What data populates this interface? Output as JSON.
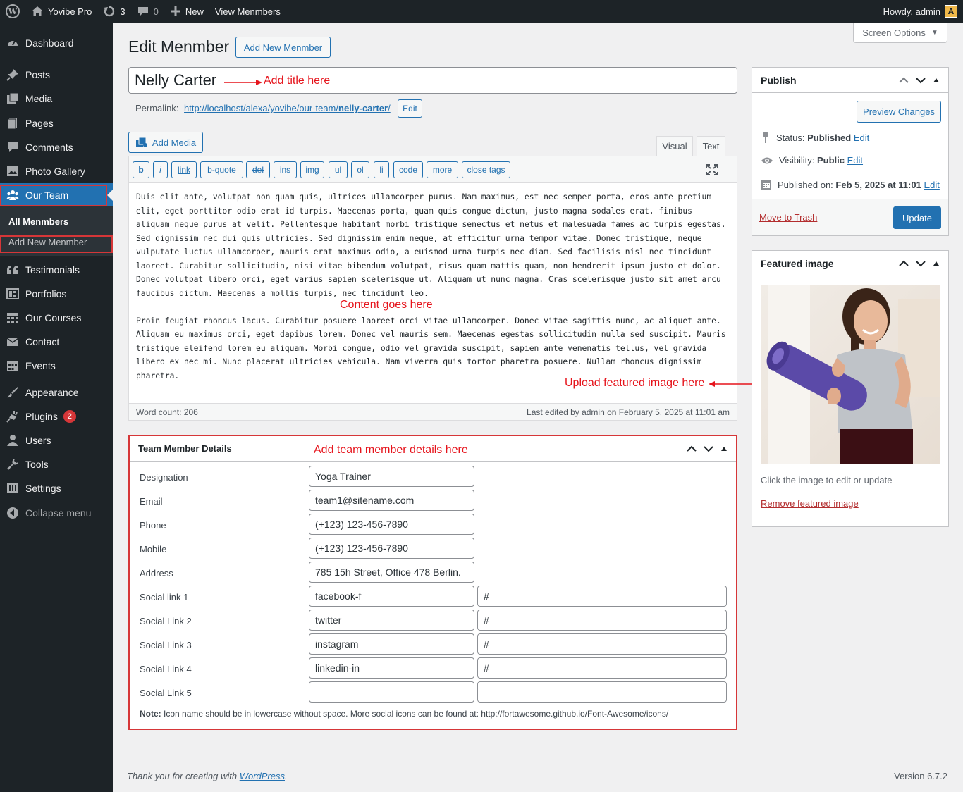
{
  "adminbar": {
    "site_name": "Yovibe Pro",
    "updates_count": "3",
    "comments_count": "0",
    "new_label": "New",
    "view_label": "View Menmbers",
    "howdy": "Howdy, admin",
    "avatar_letter": "A"
  },
  "sidebar": {
    "items": [
      {
        "label": "Dashboard",
        "icon": "dashboard-icon"
      },
      {
        "label": "Posts",
        "icon": "pin-icon"
      },
      {
        "label": "Media",
        "icon": "media-icon"
      },
      {
        "label": "Pages",
        "icon": "pages-icon"
      },
      {
        "label": "Comments",
        "icon": "comment-icon"
      },
      {
        "label": "Photo Gallery",
        "icon": "gallery-icon"
      },
      {
        "label": "Our Team",
        "icon": "team-icon"
      },
      {
        "label": "Testimonials",
        "icon": "quote-icon"
      },
      {
        "label": "Portfolios",
        "icon": "portfolio-icon"
      },
      {
        "label": "Our Courses",
        "icon": "grid-icon"
      },
      {
        "label": "Contact",
        "icon": "mail-icon"
      },
      {
        "label": "Events",
        "icon": "calendar-icon"
      },
      {
        "label": "Appearance",
        "icon": "brush-icon"
      },
      {
        "label": "Plugins",
        "icon": "plugin-icon"
      },
      {
        "label": "Users",
        "icon": "user-icon"
      },
      {
        "label": "Tools",
        "icon": "wrench-icon"
      },
      {
        "label": "Settings",
        "icon": "settings-icon"
      },
      {
        "label": "Collapse menu",
        "icon": "collapse-icon"
      }
    ],
    "submenu": {
      "all": "All Menmbers",
      "add_new": "Add New Menmber"
    },
    "plugins_badge": "2"
  },
  "header": {
    "screen_options": "Screen Options",
    "title": "Edit Menmber",
    "add_new": "Add New Menmber"
  },
  "post": {
    "title": "Nelly Carter",
    "permalink_label": "Permalink:",
    "permalink_base": "http://localhost/alexa/yovibe/our-team/",
    "permalink_slug": "nelly-carter",
    "permalink_trail": "/",
    "permalink_edit": "Edit"
  },
  "annotations": {
    "title": "Add title here",
    "content": "Content goes here",
    "featured": "Upload featured image here",
    "details": "Add team member details here"
  },
  "editor": {
    "add_media": "Add Media",
    "tab_visual": "Visual",
    "tab_text": "Text",
    "quicktags": [
      "b",
      "i",
      "link",
      "b-quote",
      "del",
      "ins",
      "img",
      "ul",
      "ol",
      "li",
      "code",
      "more",
      "close tags"
    ],
    "paragraph1": "Duis elit ante, volutpat non quam quis, ultrices ullamcorper purus. Nam maximus, est nec semper porta, eros ante pretium elit, eget porttitor odio erat id turpis. Maecenas porta, quam quis congue dictum, justo magna sodales erat, finibus aliquam neque purus at velit. Pellentesque habitant morbi tristique senectus et netus et malesuada fames ac turpis egestas. Sed dignissim nec dui quis ultricies. Sed dignissim enim neque, at efficitur urna tempor vitae. Donec tristique, neque vulputate luctus ullamcorper, mauris erat maximus odio, a euismod urna turpis nec diam. Sed facilisis nisl nec tincidunt laoreet. Curabitur sollicitudin, nisi vitae bibendum volutpat, risus quam mattis quam, non hendrerit ipsum justo et dolor. Donec volutpat libero orci, eget varius sapien scelerisque ut. Aliquam ut nunc magna. Cras scelerisque justo sit amet arcu faucibus dictum. Maecenas a mollis turpis, nec tincidunt leo.",
    "paragraph2": "Proin feugiat rhoncus lacus. Curabitur posuere laoreet orci vitae ullamcorper. Donec vitae sagittis nunc, ac aliquet ante. Aliquam eu maximus orci, eget dapibus lorem. Donec vel mauris sem. Maecenas egestas sollicitudin nulla sed suscipit. Mauris tristique eleifend lorem eu aliquam. Morbi congue, odio vel gravida suscipit, sapien ante venenatis tellus, vel gravida libero ex nec mi. Nunc placerat ultricies vehicula. Nam viverra quis tortor pharetra posuere. Nullam rhoncus dignissim pharetra.",
    "word_count": "Word count: 206",
    "last_edited": "Last edited by admin on February 5, 2025 at 11:01 am"
  },
  "details": {
    "title": "Team Member Details",
    "fields": [
      {
        "label": "Designation",
        "value": "Yoga Trainer"
      },
      {
        "label": "Email",
        "value": "team1@sitename.com"
      },
      {
        "label": "Phone",
        "value": "(+123) 123-456-7890"
      },
      {
        "label": "Mobile",
        "value": "(+123) 123-456-7890"
      },
      {
        "label": "Address",
        "value": "785 15h Street, Office 478 Berlin."
      }
    ],
    "social": [
      {
        "label": "Social link 1",
        "icon": "facebook-f",
        "url": "#"
      },
      {
        "label": "Social Link 2",
        "icon": "twitter",
        "url": "#"
      },
      {
        "label": "Social Link 3",
        "icon": "instagram",
        "url": "#"
      },
      {
        "label": "Social Link 4",
        "icon": "linkedin-in",
        "url": "#"
      },
      {
        "label": "Social Link 5",
        "icon": "",
        "url": ""
      }
    ],
    "note_label": "Note:",
    "note_text": "Icon name should be in lowercase without space. More social icons can be found at: http://fortawesome.github.io/Font-Awesome/icons/"
  },
  "publish": {
    "title": "Publish",
    "preview": "Preview Changes",
    "status_label": "Status:",
    "status_value": "Published",
    "visibility_label": "Visibility:",
    "visibility_value": "Public",
    "published_label": "Published on:",
    "published_value": "Feb 5, 2025 at 11:01",
    "edit": "Edit",
    "trash": "Move to Trash",
    "update": "Update"
  },
  "featured": {
    "title": "Featured image",
    "hint": "Click the image to edit or update",
    "remove": "Remove featured image"
  },
  "footer": {
    "thanks_prefix": "Thank you for creating with",
    "thanks_link": "WordPress",
    "thanks_suffix": ".",
    "version": "Version 6.7.2"
  },
  "colors": {
    "accent": "#2271b1",
    "sidebar_bg": "#1d2327",
    "annotation_red": "#e6141c"
  }
}
